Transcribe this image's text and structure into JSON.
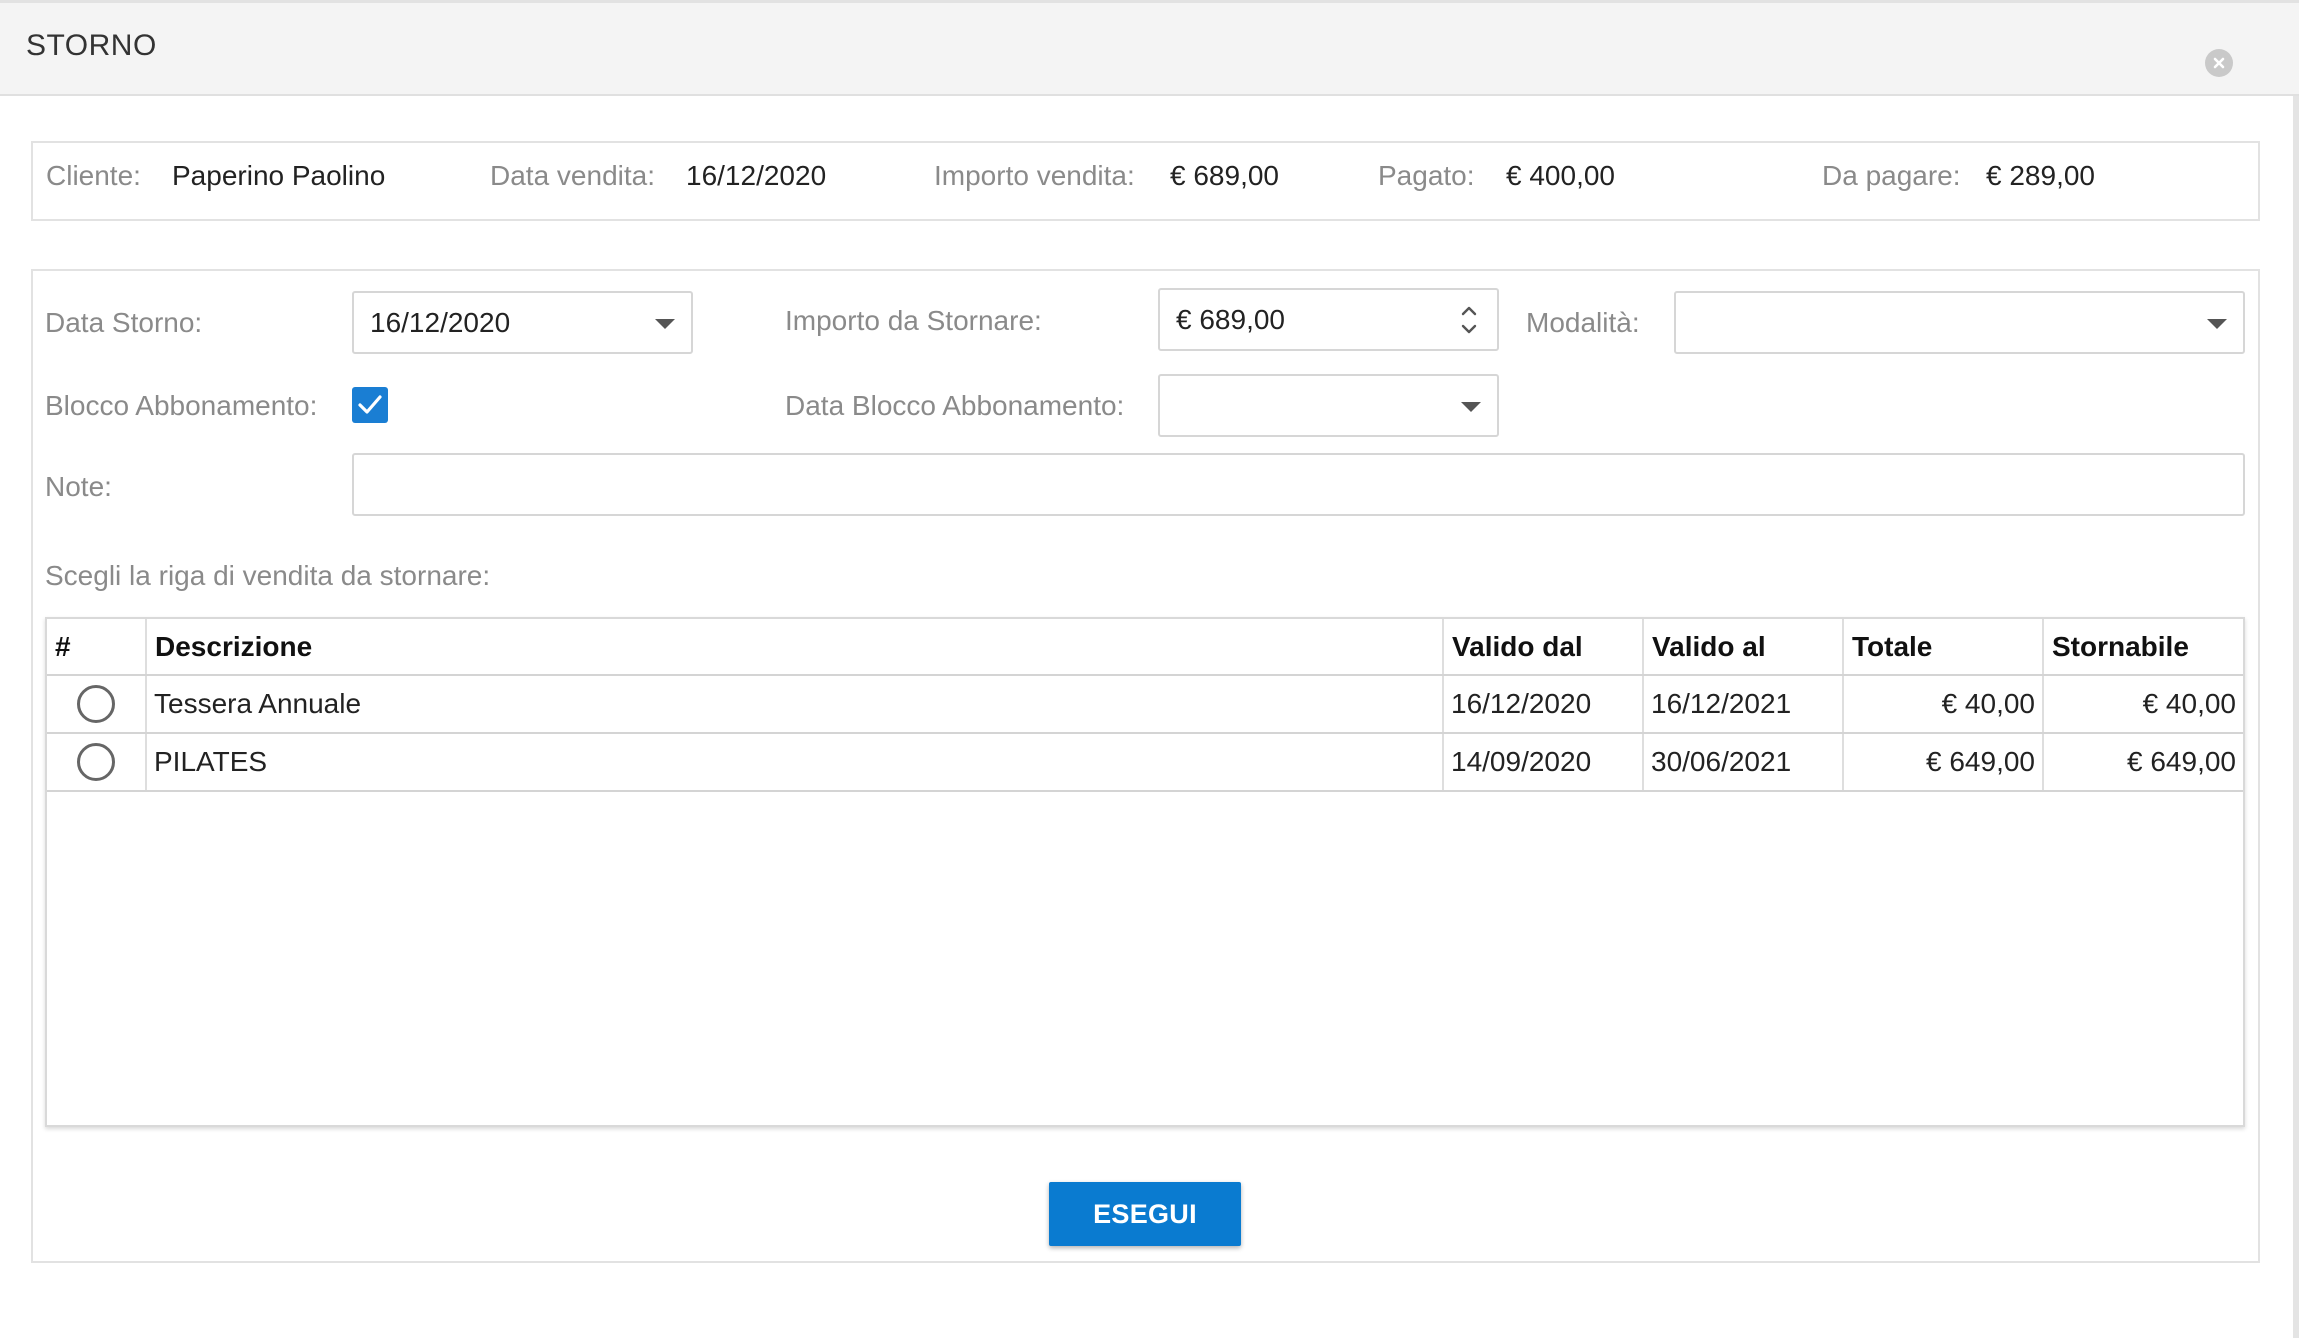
{
  "dialog": {
    "title": "STORNO"
  },
  "summary": {
    "cliente_label": "Cliente:",
    "cliente_value": "Paperino Paolino",
    "data_vendita_label": "Data vendita:",
    "data_vendita_value": "16/12/2020",
    "importo_vendita_label": "Importo vendita:",
    "importo_vendita_value": "€ 689,00",
    "pagato_label": "Pagato:",
    "pagato_value": "€ 400,00",
    "da_pagare_label": "Da pagare:",
    "da_pagare_value": "€ 289,00"
  },
  "form": {
    "data_storno_label": "Data Storno:",
    "data_storno_value": "16/12/2020",
    "importo_label": "Importo da Stornare:",
    "importo_value": "€ 689,00",
    "modalita_label": "Modalità:",
    "modalita_value": "",
    "blocco_label": "Blocco Abbonamento:",
    "blocco_checked": true,
    "data_blocco_label": "Data Blocco Abbonamento:",
    "data_blocco_value": "",
    "note_label": "Note:",
    "note_value": "",
    "scegli_label": "Scegli la riga di vendita da stornare:"
  },
  "table": {
    "headers": [
      "#",
      "Descrizione",
      "Valido dal",
      "Valido al",
      "Totale",
      "Stornabile"
    ],
    "rows": [
      {
        "descrizione": "Tessera Annuale",
        "valido_dal": "16/12/2020",
        "valido_al": "16/12/2021",
        "totale": "€ 40,00",
        "stornabile": "€ 40,00"
      },
      {
        "descrizione": "PILATES",
        "valido_dal": "14/09/2020",
        "valido_al": "30/06/2021",
        "totale": "€ 649,00",
        "stornabile": "€ 649,00"
      }
    ]
  },
  "actions": {
    "esegui_label": "ESEGUI"
  },
  "icons": {
    "close": "close-circle-icon",
    "dropdown": "caret-down-icon",
    "spinner": "chevron-up-down-icon",
    "checkbox": "check-icon",
    "radio": "radio-empty-icon"
  },
  "colors": {
    "accent": "#0a7bd0",
    "checkbox": "#1a7ed3",
    "titlebar": "#f4f4f4",
    "label_gray": "#8a8a8a"
  }
}
